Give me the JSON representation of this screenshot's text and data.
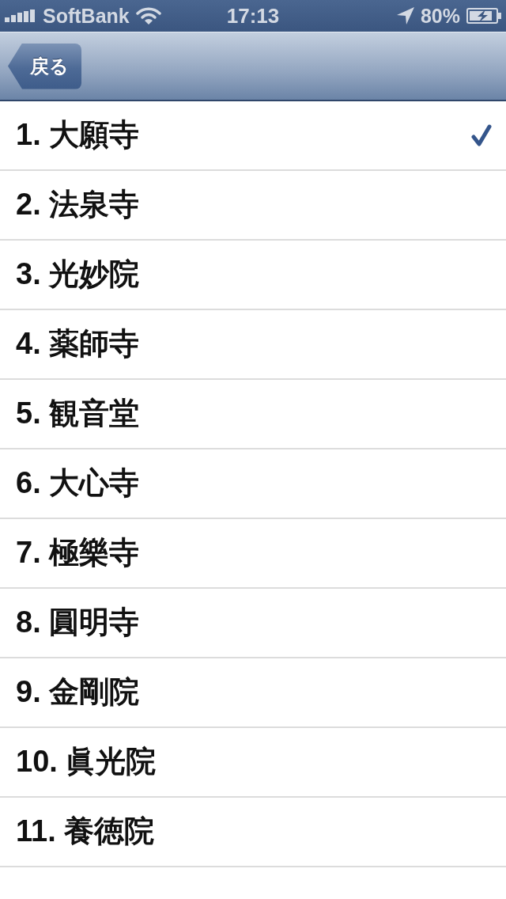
{
  "status_bar": {
    "carrier": "SoftBank",
    "time": "17:13",
    "battery": "80%"
  },
  "nav_bar": {
    "back_button": "戻る"
  },
  "list": {
    "items": [
      {
        "label": "1. 大願寺",
        "selected": true
      },
      {
        "label": "2. 法泉寺",
        "selected": false
      },
      {
        "label": "3. 光妙院",
        "selected": false
      },
      {
        "label": "4. 薬師寺",
        "selected": false
      },
      {
        "label": "5. 観音堂",
        "selected": false
      },
      {
        "label": "6. 大心寺",
        "selected": false
      },
      {
        "label": "7. 極樂寺",
        "selected": false
      },
      {
        "label": "8. 圓明寺",
        "selected": false
      },
      {
        "label": "9. 金剛院",
        "selected": false
      },
      {
        "label": "10. 眞光院",
        "selected": false
      },
      {
        "label": "11. 養徳院",
        "selected": false
      }
    ]
  }
}
